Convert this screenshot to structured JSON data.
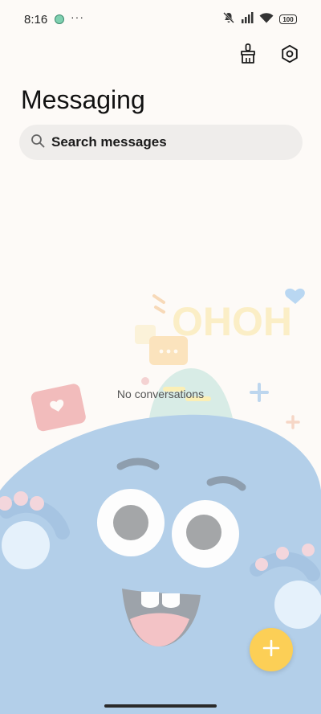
{
  "status_bar": {
    "time": "8:16",
    "overflow": "···",
    "battery": "100",
    "icons": [
      "app-notification-icon",
      "mute-icon",
      "signal-icon",
      "wifi-icon",
      "battery-icon"
    ]
  },
  "header": {
    "title": "Messaging",
    "actions": [
      "clean-brush-icon",
      "settings-hexagon-icon"
    ]
  },
  "search": {
    "placeholder": "Search messages",
    "icon": "search-icon"
  },
  "empty_state": {
    "text": "No conversations",
    "illustration_text": "OHOH"
  },
  "fab": {
    "icon": "plus-icon",
    "color": "#fccf56"
  },
  "colors": {
    "background": "#fdfaf7",
    "search_bg": "#efedeb",
    "monster": "#b3cfe9",
    "accent": "#fccf56"
  }
}
